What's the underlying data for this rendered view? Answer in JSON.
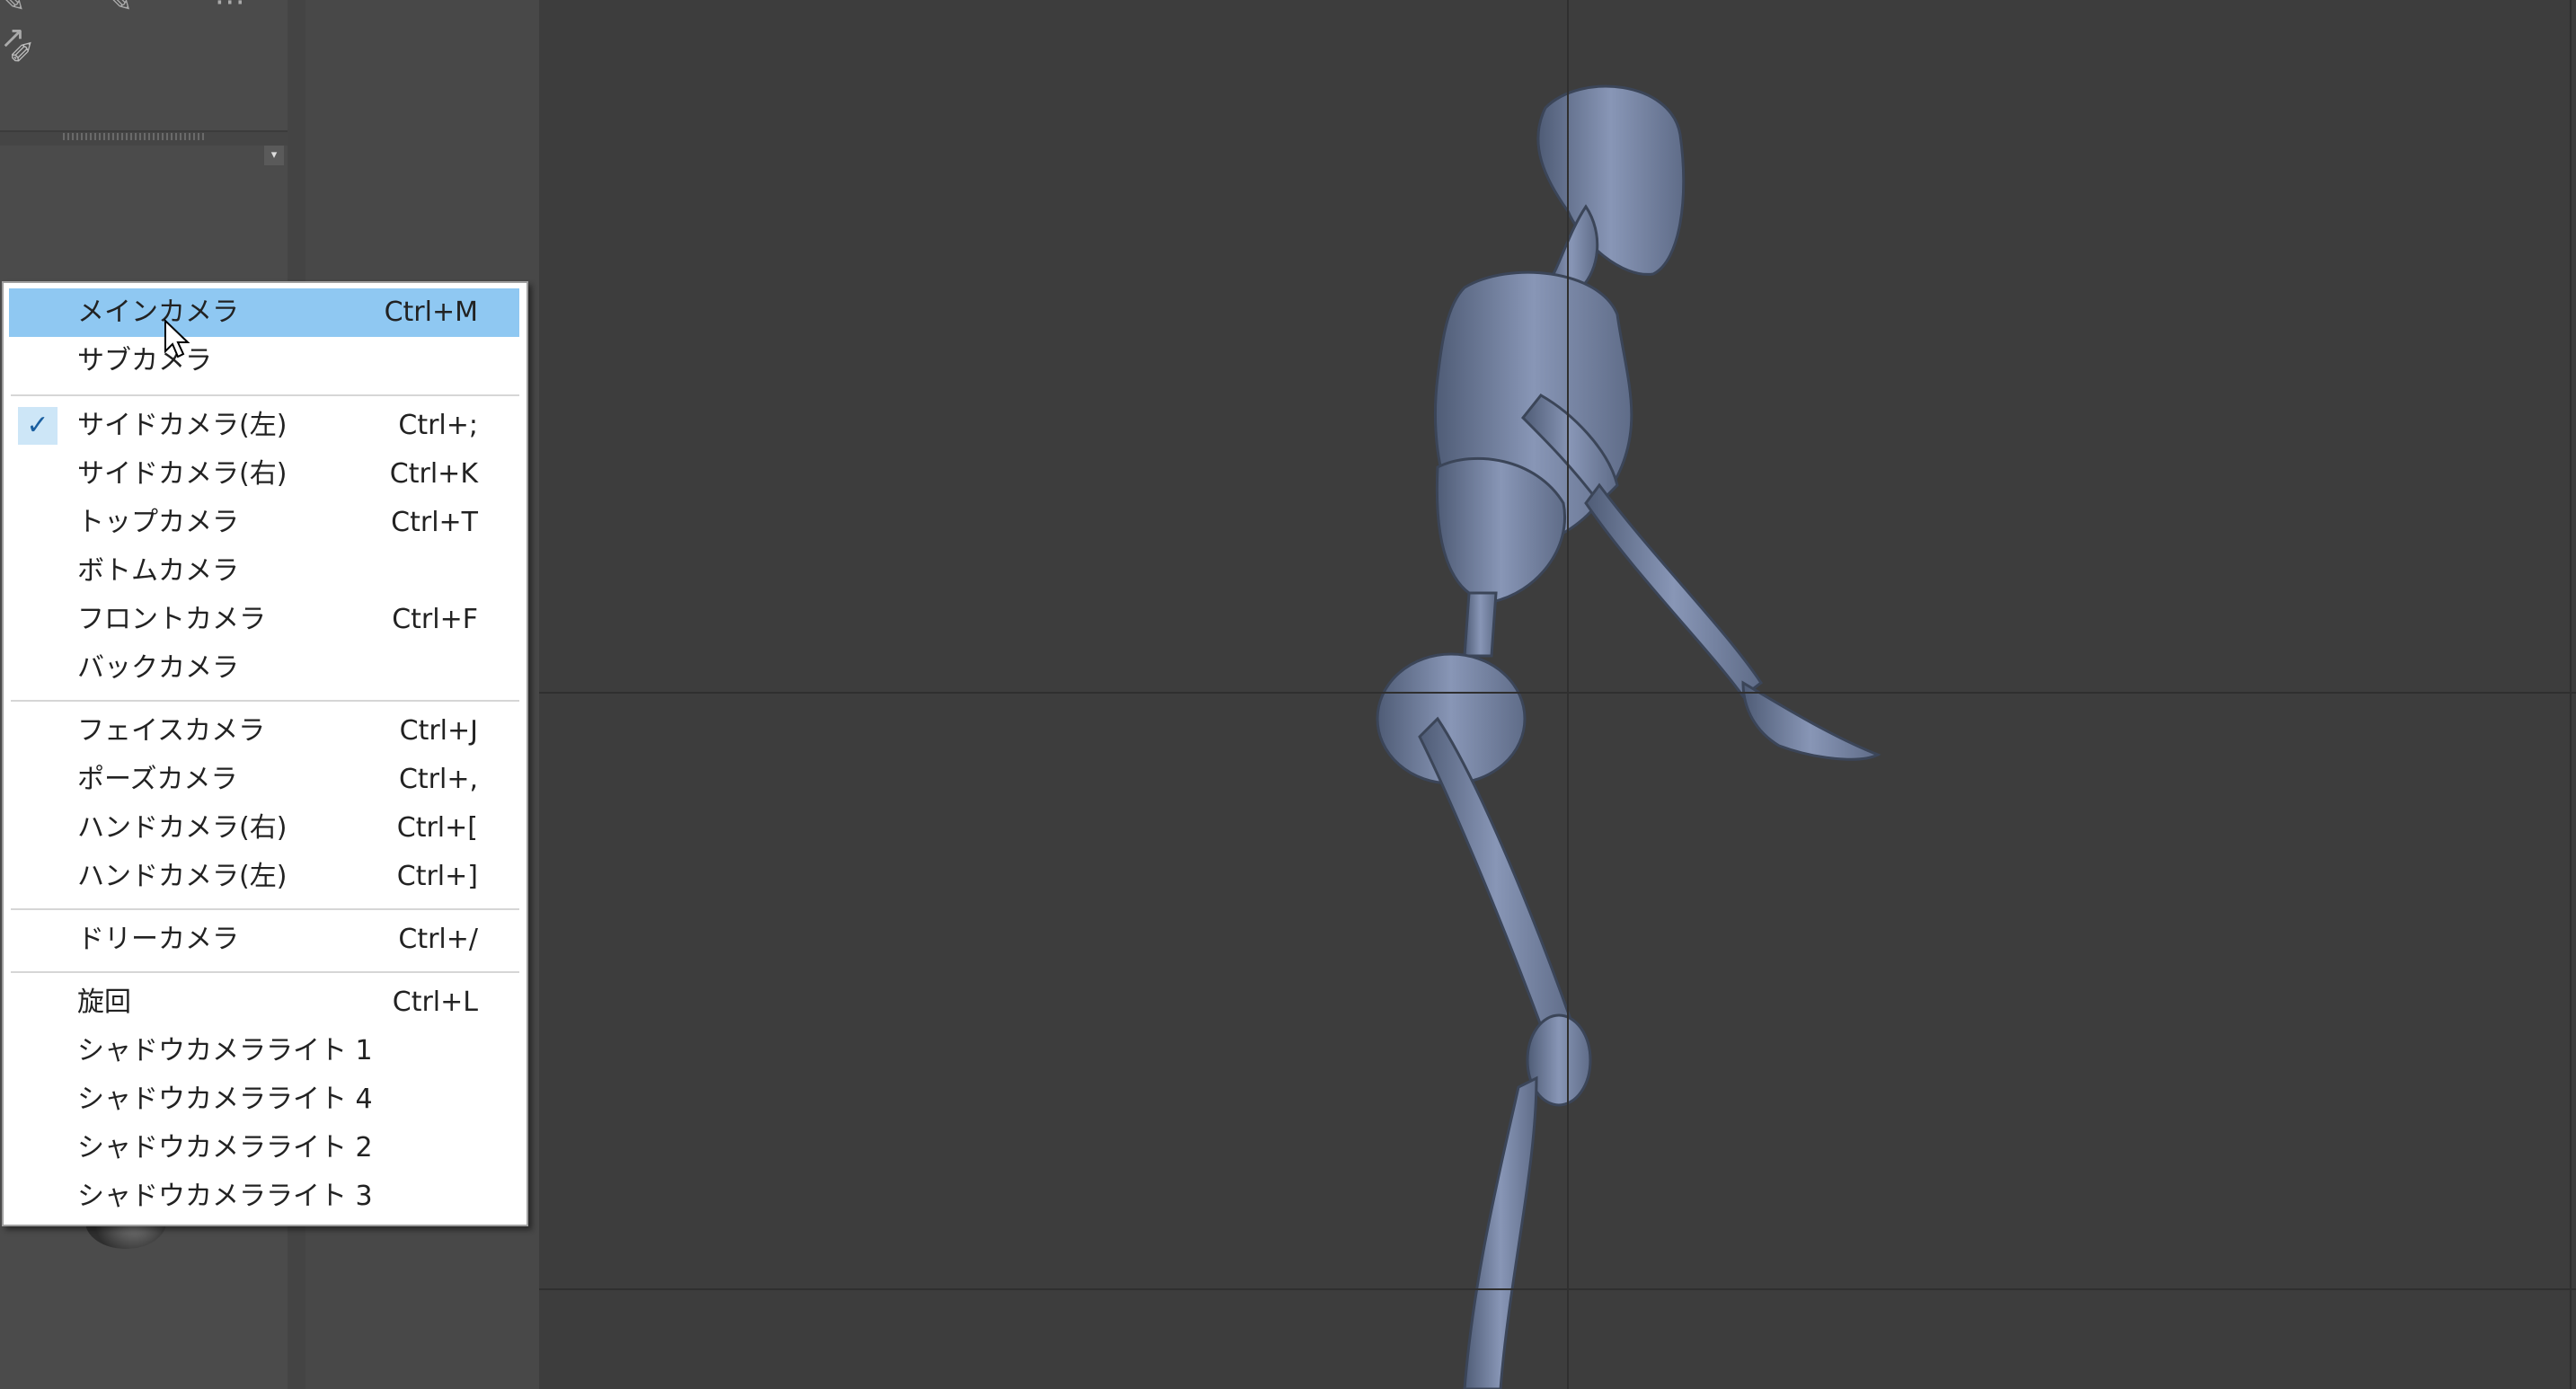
{
  "menu": {
    "items": [
      {
        "label": "メインカメラ",
        "shortcut": "Ctrl+M",
        "highlighted": true
      },
      {
        "label": "サブカメラ",
        "shortcut": ""
      },
      {
        "label": "サイドカメラ(左)",
        "shortcut": "Ctrl+;",
        "checked": true
      },
      {
        "label": "サイドカメラ(右)",
        "shortcut": "Ctrl+K"
      },
      {
        "label": "トップカメラ",
        "shortcut": "Ctrl+T"
      },
      {
        "label": "ボトムカメラ",
        "shortcut": ""
      },
      {
        "label": "フロントカメラ",
        "shortcut": "Ctrl+F"
      },
      {
        "label": "バックカメラ",
        "shortcut": ""
      },
      {
        "label": "フェイスカメラ",
        "shortcut": "Ctrl+J"
      },
      {
        "label": "ポーズカメラ",
        "shortcut": "Ctrl+,"
      },
      {
        "label": "ハンドカメラ(右)",
        "shortcut": "Ctrl+["
      },
      {
        "label": "ハンドカメラ(左)",
        "shortcut": "Ctrl+]"
      },
      {
        "label": "ドリーカメラ",
        "shortcut": "Ctrl+/"
      },
      {
        "label": "旋回",
        "shortcut": "Ctrl+L"
      },
      {
        "label": "シャドウカメラライト 1",
        "shortcut": ""
      },
      {
        "label": "シャドウカメラライト 4",
        "shortcut": ""
      },
      {
        "label": "シャドウカメラライト 2",
        "shortcut": ""
      },
      {
        "label": "シャドウカメラライト 3",
        "shortcut": ""
      }
    ]
  },
  "icons": {
    "check": "check-icon",
    "dropdown": "dropdown-arrow-icon",
    "tool": "pen-tool-icon"
  },
  "colors": {
    "highlight": "#8fc8f2",
    "check_bg": "#cde6f7",
    "figure": "#7b8aa8",
    "viewport": "#3d3d3d"
  }
}
